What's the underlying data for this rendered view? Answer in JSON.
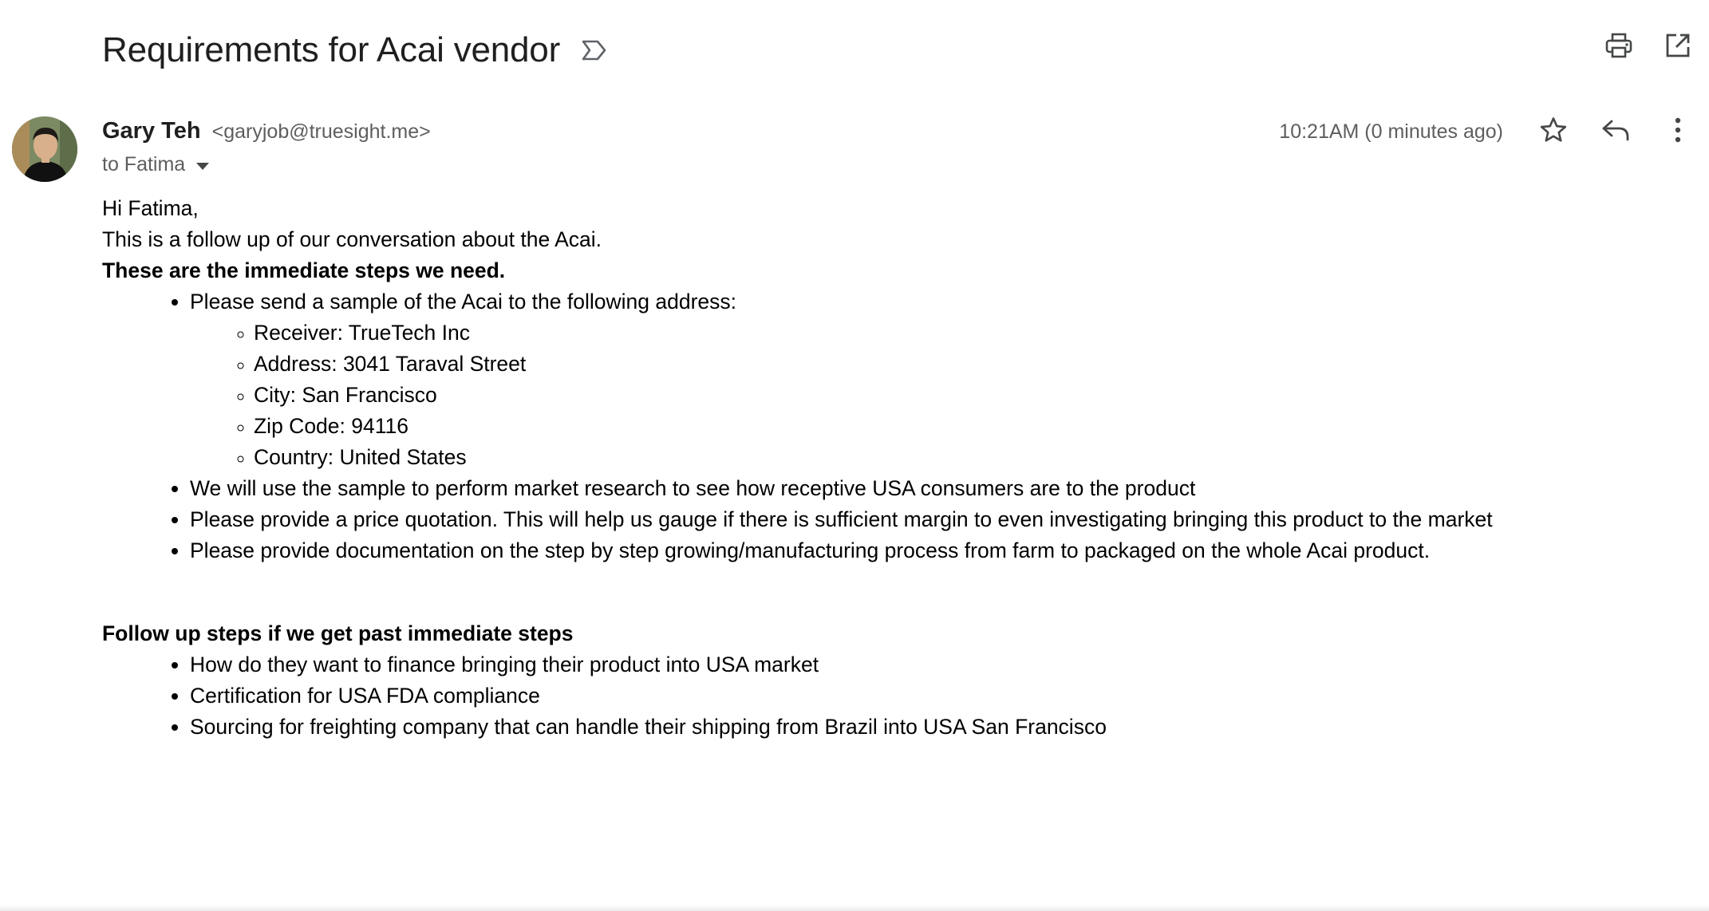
{
  "email": {
    "subject": "Requirements for Acai vendor",
    "sender_name": "Gary Teh",
    "sender_email": "<garyjob@truesight.me>",
    "to_label": "to Fatima",
    "timestamp": "10:21AM (0 minutes ago)"
  },
  "toolbar": {
    "print_icon": "print-icon",
    "open_new_window_icon": "open-in-new-icon",
    "star_icon": "star-icon",
    "reply_icon": "reply-icon",
    "more_icon": "more-vert-icon",
    "importance_icon": "label-important-icon"
  },
  "body": {
    "greeting": "Hi Fatima,",
    "intro": "This is a follow up of our conversation about the Acai.",
    "section1_heading": "These are the immediate steps we need.",
    "section1_items": [
      "Please send a sample of the Acai to the following address:",
      "We will use the sample to perform market research to see how receptive USA consumers are to the product",
      "Please provide a price quotation. This will help us gauge if there is sufficient margin to even investigating bringing this product to the market",
      "Please provide documentation on the step by step growing/manufacturing process from farm to packaged on the whole Acai product."
    ],
    "address_items": [
      "Receiver: TrueTech Inc",
      "Address: 3041 Taraval Street",
      "City: San Francisco",
      "Zip Code: 94116",
      "Country: United States"
    ],
    "section2_heading": "Follow up steps if we get past immediate steps",
    "section2_items": [
      "How do they want to finance bringing their product into USA market",
      "Certification for USA FDA compliance",
      "Sourcing for freighting company that can handle their shipping from Brazil into USA San Francisco"
    ]
  }
}
